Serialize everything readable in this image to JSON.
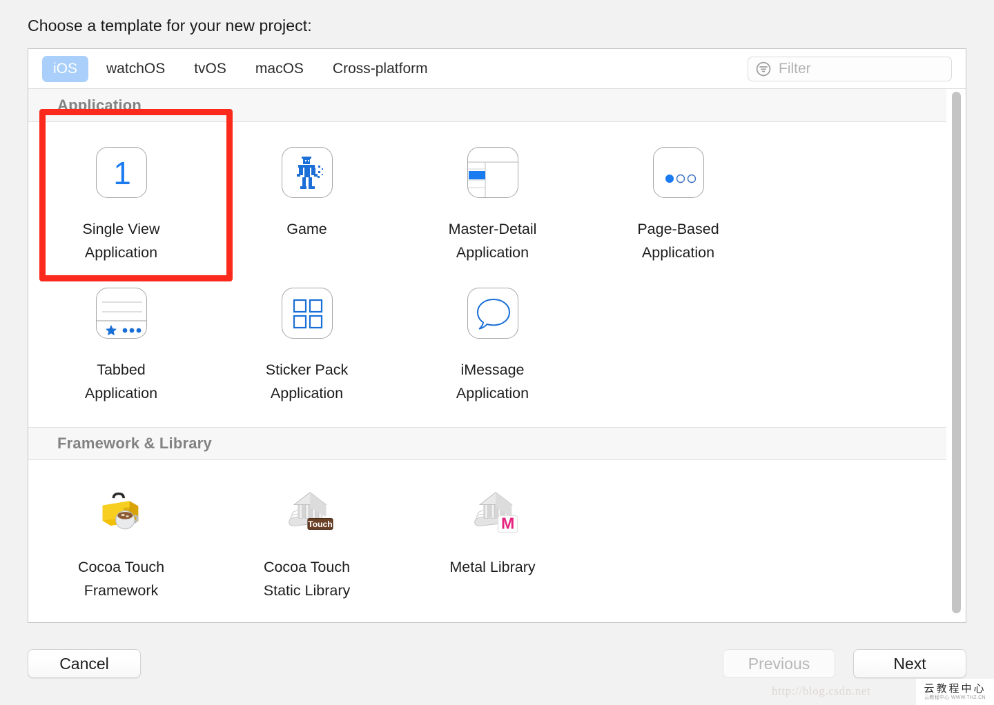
{
  "prompt": "Choose a template for your new project:",
  "tabs": [
    {
      "label": "iOS",
      "active": true
    },
    {
      "label": "watchOS",
      "active": false
    },
    {
      "label": "tvOS",
      "active": false
    },
    {
      "label": "macOS",
      "active": false
    },
    {
      "label": "Cross-platform",
      "active": false
    }
  ],
  "filter": {
    "placeholder": "Filter",
    "value": "",
    "icon": "filter-icon"
  },
  "sections": [
    {
      "title": "Application",
      "templates": [
        {
          "label": "Single View\nApplication",
          "line1": "Single View",
          "line2": "Application",
          "icon": "single-view-icon",
          "selected": true
        },
        {
          "label": "Game",
          "line1": "Game",
          "line2": "",
          "icon": "game-robot-icon",
          "selected": false
        },
        {
          "label": "Master-Detail\nApplication",
          "line1": "Master-Detail",
          "line2": "Application",
          "icon": "master-detail-icon",
          "selected": false
        },
        {
          "label": "Page-Based\nApplication",
          "line1": "Page-Based",
          "line2": "Application",
          "icon": "page-based-icon",
          "selected": false
        },
        {
          "label": "Tabbed\nApplication",
          "line1": "Tabbed",
          "line2": "Application",
          "icon": "tabbed-icon",
          "selected": false
        },
        {
          "label": "Sticker Pack\nApplication",
          "line1": "Sticker Pack",
          "line2": "Application",
          "icon": "sticker-pack-icon",
          "selected": false
        },
        {
          "label": "iMessage\nApplication",
          "line1": "iMessage",
          "line2": "Application",
          "icon": "imessage-bubble-icon",
          "selected": false
        }
      ]
    },
    {
      "title": "Framework & Library",
      "templates": [
        {
          "label": "Cocoa Touch\nFramework",
          "line1": "Cocoa Touch",
          "line2": "Framework",
          "icon": "toolbox-coffee-icon",
          "selected": false
        },
        {
          "label": "Cocoa Touch\nStatic Library",
          "line1": "Cocoa Touch",
          "line2": "Static Library",
          "icon": "temple-touch-icon",
          "selected": false,
          "badge": "Touch"
        },
        {
          "label": "Metal Library",
          "line1": "Metal Library",
          "line2": "",
          "icon": "temple-metal-icon",
          "selected": false,
          "badge": "M"
        }
      ]
    }
  ],
  "footer": {
    "cancel": "Cancel",
    "previous": "Previous",
    "next": "Next",
    "previous_disabled": true
  },
  "watermark": {
    "url": "http://blog.csdn.net",
    "badge_main": "云教程中心",
    "badge_sub": "云教程中心  WWW.THZ.CN"
  },
  "colors": {
    "accent_blue": "#1a7af0",
    "tab_active_bg": "#a9cffa",
    "annotation_red": "#fc2a1c",
    "section_header_text": "#828282",
    "dialog_bg": "#ffffff",
    "page_bg": "#f2f2f2",
    "metal_badge": "#e5237e",
    "touch_badge": "#6b4228",
    "toolbox_yellow": "#f2c009"
  }
}
